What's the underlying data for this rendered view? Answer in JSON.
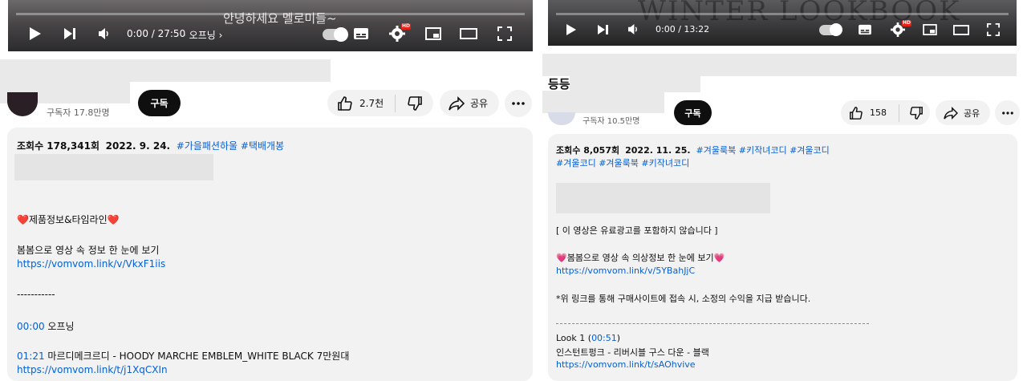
{
  "left": {
    "player": {
      "overlay_text": "안녕하세요 멜로미들~",
      "time": "0:00 / 27:50",
      "chapter": "오프닝",
      "hd_badge": "HD"
    },
    "channel": {
      "subscribers": "구독자 17.8만명",
      "subscribe_label": "구독"
    },
    "actions": {
      "likes": "2.7천",
      "share": "공유"
    },
    "description": {
      "views": "조회수 178,341회",
      "date": "2022. 9. 24.",
      "tags": [
        "#가을패션하울",
        "#택배개봉"
      ],
      "product_heading": "❤️제품정보&타임라인❤️",
      "vomvom_text": "봄봄으로 영상 속 정보 한 눈에 보기",
      "vomvom_link": "https://vomvom.link/v/VkxF1iis",
      "separator": "-----------",
      "timeline": [
        {
          "time": "00:00",
          "label": "오프닝"
        },
        {
          "time": "01:21",
          "label": "마르디메크르디 - HOODY MARCHE EMBLEM_WHITE BLACK 7만원대"
        }
      ],
      "item_link": "https://vomvom.link/t/j1XqCXIn"
    }
  },
  "right": {
    "player": {
      "overlay_text": "WINTER LOOKBOOK",
      "time": "0:00 / 13:22",
      "hd_badge": "HD"
    },
    "title_fragment": "등등|",
    "channel": {
      "subscribers": "구독자 10.5만명",
      "subscribe_label": "구독"
    },
    "actions": {
      "likes": "158",
      "share": "공유"
    },
    "description": {
      "views": "조회수 8,057회",
      "date": "2022. 11. 25.",
      "tags_line1": [
        "#겨울룩북",
        "#키작녀코디",
        "#겨울코디"
      ],
      "tags_line2": [
        "#겨울코디",
        "#겨울룩북",
        "#키작녀코디"
      ],
      "ad_notice": "[ 이 영상은 유료광고를 포함하지 않습니다 ]",
      "vomvom_text": "💗봄봄으로 영상 속 의상정보 한 눈에 보기💗",
      "vomvom_link": "https://vomvom.link/v/5YBahJjC",
      "commission_note": "*위 링크를 통해 구매사이트에 접속 시, 소정의 수익을 지급 받습니다.",
      "look_label": "Look 1 (",
      "look_time": "00:51",
      "look_close": ")",
      "item_text": "인스턴트펑크 - 리버시블 구스 다운 - 블랙",
      "item_link": "https://vomvom.link/t/sAOhvive"
    }
  }
}
